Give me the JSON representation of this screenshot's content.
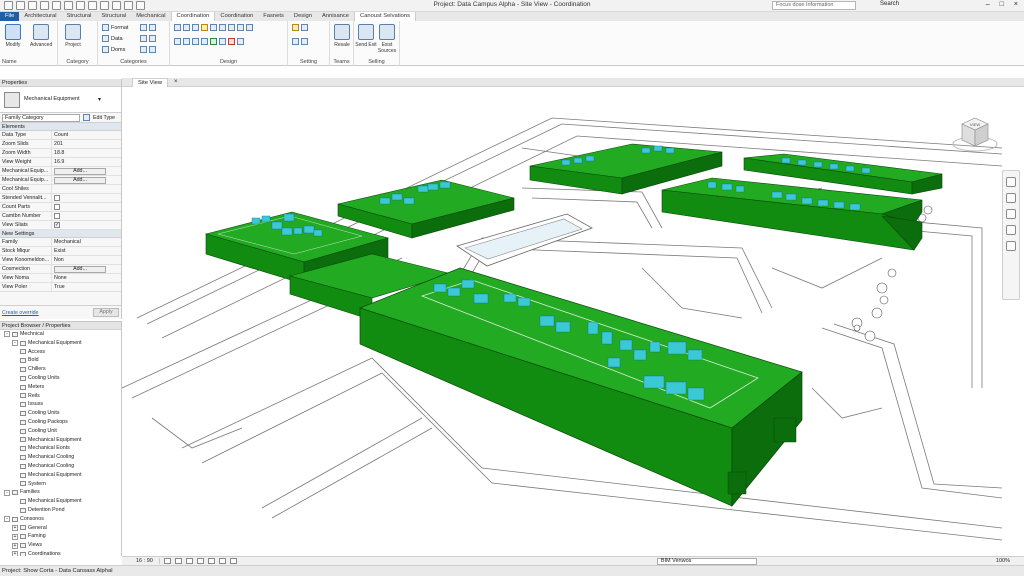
{
  "titlebar": {
    "title": "Project: Data Campus Alpha - Site View - Coordination",
    "search_placeholder": "Focus dose Information",
    "signin": "Search"
  },
  "ribbon_tabs": [
    "File",
    "Architectural",
    "Structural",
    "Structural",
    "Mechanical",
    "Coordination",
    "Coordination",
    "Fasnets",
    "Design",
    "Annisance",
    "Canoust Selvations"
  ],
  "ribbon": {
    "modify_label": "Modify",
    "name_label": "Name",
    "advanced_label": "Advanced",
    "project_label": "Project",
    "category_label": "Category",
    "format_label": "Format",
    "data_label": "Data",
    "doms_label": "Doms",
    "categories_label": "Categories",
    "design_label": "Design",
    "setting_label": "Setting",
    "resale_label": "Resale",
    "teams_label": "Teams",
    "send_exit_label": "Send Exit",
    "exist_sources_label": "Exist Sources",
    "selling_label": "Selling"
  },
  "properties": {
    "header": "Properties",
    "type_name": "Mechanical Equipment",
    "filter_value": "Family Category",
    "edit_type": "Edit Type",
    "sections": {
      "s1": "Elements",
      "s2": "New Settings"
    },
    "rows1": [
      {
        "k": "Data Type",
        "v": "Count"
      },
      {
        "k": "Zoom Slids",
        "v": "201"
      },
      {
        "k": "Zoom Width",
        "v": "18.8"
      },
      {
        "k": "View Weight",
        "v": "16.9"
      },
      {
        "k": "Mechanical Equip...",
        "btn": "Add..."
      },
      {
        "k": "Mechanical Equip...",
        "btn": "Add..."
      },
      {
        "k": "Cool Shiles",
        "v": ""
      },
      {
        "k": "Stended Vennalit...",
        "cb": "off"
      },
      {
        "k": "Count Parts",
        "cb": "off"
      },
      {
        "k": "Camtbn Number",
        "cb": "off"
      },
      {
        "k": "View Sliats",
        "cb": "on"
      }
    ],
    "rows2": [
      {
        "k": "Family",
        "v": "Mechanical"
      },
      {
        "k": "Stock Miqur",
        "v": "Exist"
      },
      {
        "k": "View Kooomeldon...",
        "v": "Non"
      },
      {
        "k": "Cosmection",
        "btn": "Add..."
      },
      {
        "k": "View Noma",
        "v": "None"
      },
      {
        "k": "View Poler",
        "v": "True"
      }
    ],
    "help_link": "Create override",
    "apply": "Apply"
  },
  "browser": {
    "header": "Project Browser / Properties",
    "nodes": [
      {
        "t": "Mechnical",
        "lvl": 0,
        "ex": "-"
      },
      {
        "t": "Mechanical Equipment",
        "lvl": 1,
        "ex": "-"
      },
      {
        "t": "Access",
        "lvl": 2
      },
      {
        "t": "Bold",
        "lvl": 2
      },
      {
        "t": "Chillers",
        "lvl": 2
      },
      {
        "t": "Cooling Units",
        "lvl": 2
      },
      {
        "t": "Meters",
        "lvl": 2
      },
      {
        "t": "Reils",
        "lvl": 2
      },
      {
        "t": "Issuss",
        "lvl": 2
      },
      {
        "t": "Cooling Units",
        "lvl": 2
      },
      {
        "t": "Cooling Packops",
        "lvl": 2
      },
      {
        "t": "Cooling Unit",
        "lvl": 2
      },
      {
        "t": "Mechanical Equipment",
        "lvl": 2
      },
      {
        "t": "Mechanical Eonts",
        "lvl": 2
      },
      {
        "t": "Mechanical Cooling",
        "lvl": 2
      },
      {
        "t": "Mechanical Cooling",
        "lvl": 2
      },
      {
        "t": "Mechanical Equipment",
        "lvl": 2
      },
      {
        "t": "Systern",
        "lvl": 2
      },
      {
        "t": "Families",
        "lvl": 0,
        "ex": "-"
      },
      {
        "t": "Mechanical Equipment",
        "lvl": 2
      },
      {
        "t": "Detention Pond",
        "lvl": 2
      },
      {
        "t": "Consonos",
        "lvl": 0,
        "ex": "-"
      },
      {
        "t": "General",
        "lvl": 1,
        "ex": "+"
      },
      {
        "t": "Faming",
        "lvl": 1,
        "ex": "+"
      },
      {
        "t": "Views",
        "lvl": 1,
        "ex": "+"
      },
      {
        "t": "Coordinations",
        "lvl": 1,
        "ex": "+"
      }
    ]
  },
  "view_tab": {
    "label": "Site View",
    "close": "×"
  },
  "viewcube_label": "VIEW",
  "view_control": {
    "scale": "16 : 90",
    "worksets": "BIM Venwos",
    "zoom": "100%"
  },
  "status": "Project: Show Corta - Data Cansass Alphal",
  "colors": {
    "roof": "#1fa21f",
    "roof_dark": "#0d6b0d",
    "equipment": "#3cc9d6",
    "file_tab": "#1f5fa8"
  }
}
